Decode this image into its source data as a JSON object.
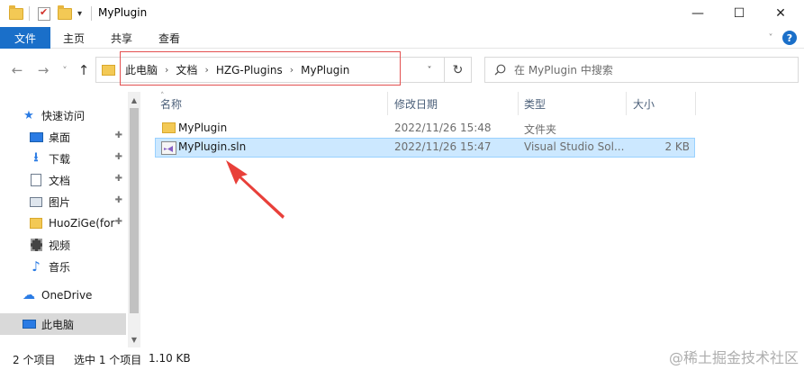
{
  "window": {
    "title": "MyPlugin",
    "minimize": "—",
    "maximize": "☐",
    "close": "✕",
    "qa_dropdown": "▾"
  },
  "ribbon": {
    "tabs": [
      "文件",
      "主页",
      "共享",
      "查看"
    ],
    "expand": "˅",
    "help": "?"
  },
  "nav": {
    "back": "←",
    "forward": "→",
    "recent": "˅",
    "up": "↑",
    "breadcrumb": [
      "此电脑",
      "文档",
      "HZG-Plugins",
      "MyPlugin"
    ],
    "separator": "›",
    "dropdown": "˅",
    "refresh": "↻"
  },
  "search": {
    "placeholder": "在 MyPlugin 中搜索"
  },
  "sidebar": {
    "items": [
      {
        "label": "快速访问",
        "icon": "star-icon",
        "color": "#2a7be4"
      },
      {
        "label": "桌面",
        "icon": "desktop-icon",
        "color": "#2a7be4",
        "pinned": true
      },
      {
        "label": "下载",
        "icon": "download-icon",
        "color": "#2a7be4",
        "pinned": true
      },
      {
        "label": "文档",
        "icon": "document-icon",
        "color": "#6d7b8d",
        "pinned": true
      },
      {
        "label": "图片",
        "icon": "picture-icon",
        "color": "#6d7b8d",
        "pinned": true
      },
      {
        "label": "HuoZiGe(for",
        "icon": "folder-icon",
        "color": "#f3c955",
        "pinned": true
      },
      {
        "label": "视频",
        "icon": "video-icon",
        "color": "#555555"
      },
      {
        "label": "音乐",
        "icon": "music-icon",
        "color": "#2a7be4"
      },
      {
        "label": "OneDrive",
        "icon": "cloud-icon",
        "color": "#2a7be4"
      },
      {
        "label": "此电脑",
        "icon": "computer-icon",
        "color": "#2a7be4",
        "selected": true
      }
    ],
    "pin": "📌",
    "scroll_up": "▲",
    "scroll_down": "▼"
  },
  "columns": {
    "name": "名称",
    "modified": "修改日期",
    "type": "类型",
    "size": "大小",
    "sort_indicator": "˄"
  },
  "files": [
    {
      "name": "MyPlugin",
      "modified": "2022/11/26 15:48",
      "type": "文件夹",
      "size": "",
      "icon": "folder-icon"
    },
    {
      "name": "MyPlugin.sln",
      "modified": "2022/11/26 15:47",
      "type": "Visual Studio Sol...",
      "size": "2 KB",
      "icon": "visual-studio-solution-icon",
      "selected": true
    }
  ],
  "status": {
    "count": "2 个项目",
    "selection": "选中 1 个项目",
    "size": "1.10 KB"
  },
  "watermark": "@稀土掘金技术社区",
  "colors": {
    "accent": "#1a6fc9",
    "selection_bg": "#cce8ff",
    "annotation_red": "#e35050"
  }
}
